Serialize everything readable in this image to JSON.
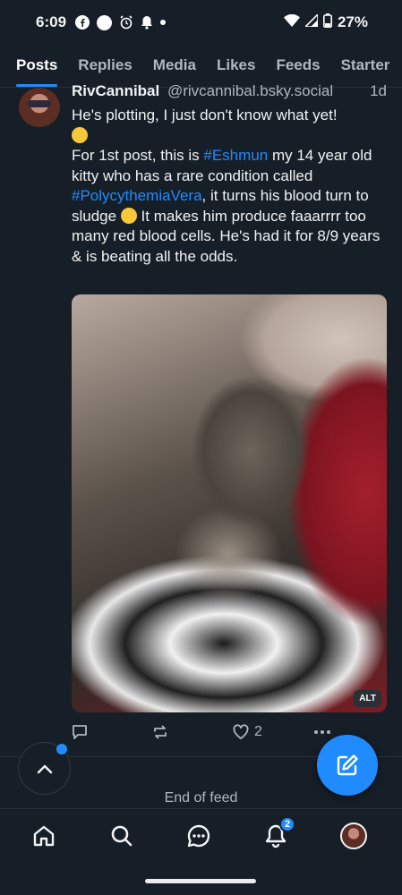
{
  "status_bar": {
    "time": "6:09",
    "battery": "27%",
    "icons": [
      "facebook-icon",
      "circle-icon",
      "alarm-icon",
      "notification-bell-icon",
      "dot-icon",
      "wifi-icon",
      "signal-icon",
      "battery-icon"
    ]
  },
  "tabs": [
    {
      "label": "Posts",
      "active": true
    },
    {
      "label": "Replies",
      "active": false
    },
    {
      "label": "Media",
      "active": false
    },
    {
      "label": "Likes",
      "active": false
    },
    {
      "label": "Feeds",
      "active": false
    },
    {
      "label": "Starter",
      "active": false
    }
  ],
  "post": {
    "display_name": "RivCannibal",
    "handle": "@rivcannibal.bsky.social",
    "age": "1d",
    "line1": "He's plotting, I just don't know what yet!",
    "para2_a": "For 1st post, this is ",
    "hashtag1": "#Eshmun",
    "para2_b": " my 14 year old kitty who has a rare condition called ",
    "hashtag2": "#PolycythemiaVera",
    "para2_c": ", it  turns his blood turn to sludge ",
    "para2_d": " It makes him produce faaarrrr too many red blood cells. He's had it for 8/9 years & is beating all the odds.",
    "image_alt_badge": "ALT",
    "like_count": "2"
  },
  "end_of_feed": "End of feed",
  "nav": {
    "notifications_badge": "2"
  },
  "colors": {
    "background": "#161e27",
    "accent": "#208bfe",
    "text": "#f1f3f5",
    "muted": "#aeb8c2"
  }
}
